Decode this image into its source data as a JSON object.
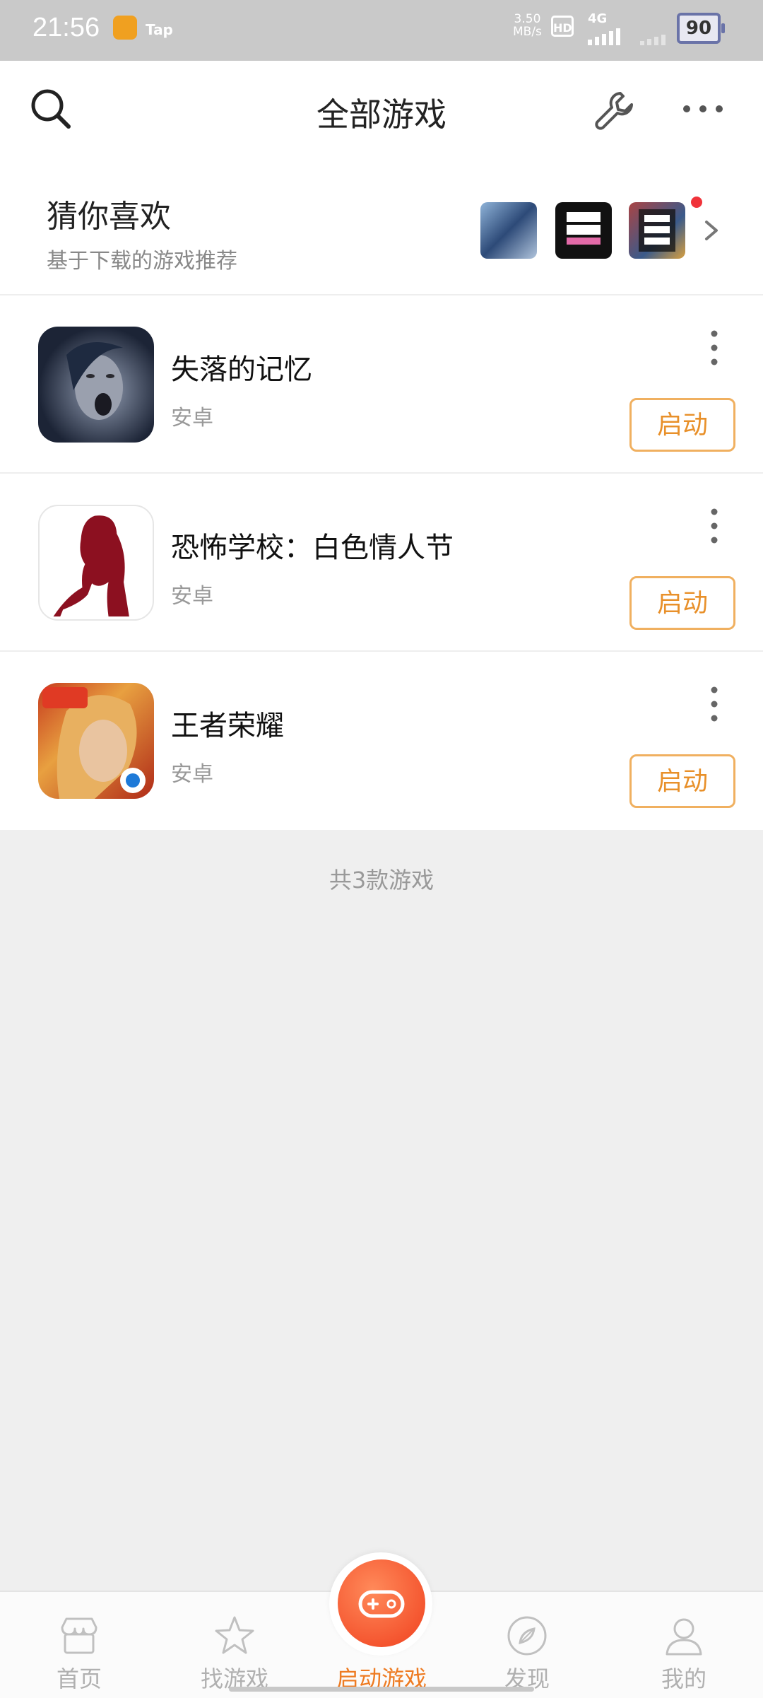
{
  "status_bar": {
    "time": "21:56",
    "app_label": "Tap",
    "speed_value": "3.50",
    "speed_unit": "MB/s",
    "hd": "HD",
    "network": "4G",
    "battery": "90"
  },
  "header": {
    "title": "全部游戏"
  },
  "recommend": {
    "title": "猜你喜欢",
    "subtitle": "基于下载的游戏推荐"
  },
  "games": [
    {
      "name": "失落的记忆",
      "platform": "安卓",
      "button": "启动"
    },
    {
      "name": "恐怖学校：白色情人节",
      "platform": "安卓",
      "button": "启动"
    },
    {
      "name": "王者荣耀",
      "platform": "安卓",
      "button": "启动"
    }
  ],
  "footer": {
    "count_text": "共3款游戏"
  },
  "bottom_nav": {
    "items": [
      {
        "label": "首页",
        "icon": "store-icon"
      },
      {
        "label": "找游戏",
        "icon": "star-icon"
      },
      {
        "label": "启动游戏",
        "icon": "gamepad-icon",
        "active": true
      },
      {
        "label": "发现",
        "icon": "compass-icon"
      },
      {
        "label": "我的",
        "icon": "person-icon"
      }
    ]
  },
  "colors": {
    "accent": "#ee7b22",
    "launch_border": "#f0b060",
    "badge": "#f0333a"
  }
}
